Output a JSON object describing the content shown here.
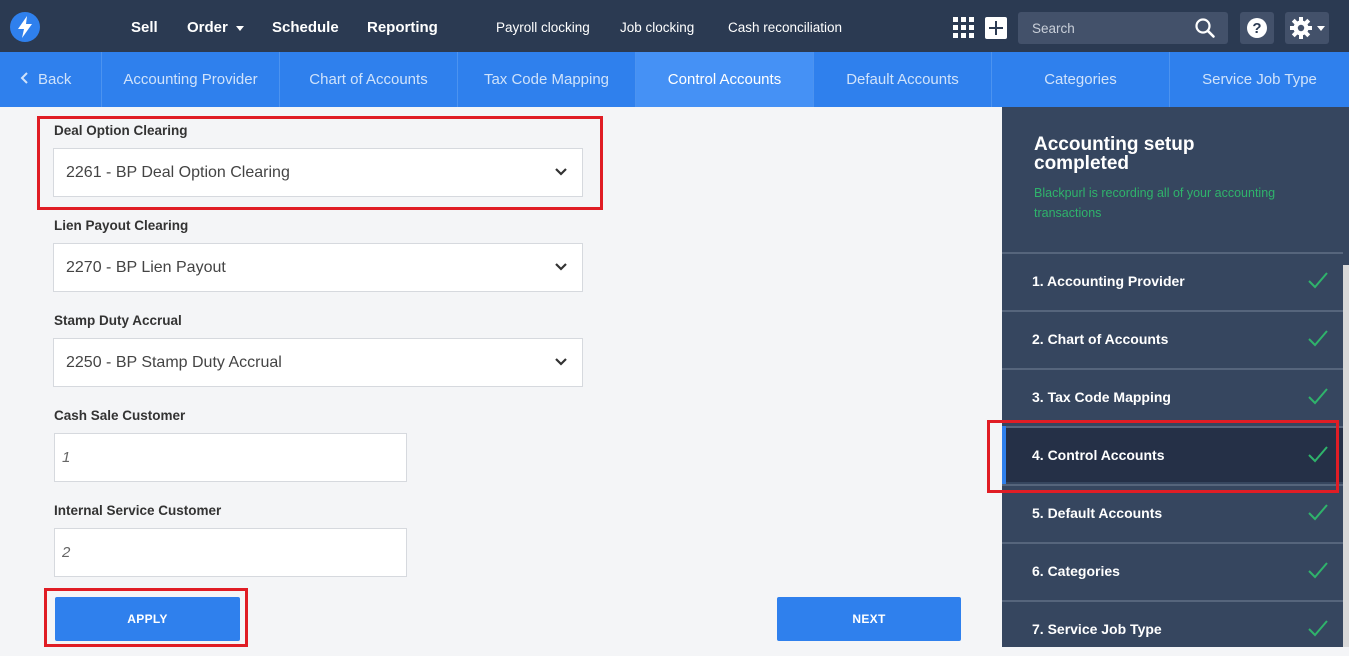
{
  "topnav": {
    "logo_icon": "lightning-bolt-icon",
    "main_items": [
      "Sell",
      "Order",
      "Schedule",
      "Reporting"
    ],
    "sub_items": [
      "Payroll clocking",
      "Job clocking",
      "Cash reconciliation"
    ],
    "search_placeholder": "Search",
    "help_label": "?"
  },
  "tabs": {
    "back": "Back",
    "items": [
      "Accounting Provider",
      "Chart of Accounts",
      "Tax Code Mapping",
      "Control Accounts",
      "Default Accounts",
      "Categories",
      "Service Job Type"
    ],
    "active": "Control Accounts"
  },
  "form": {
    "deal_option_clearing": {
      "label": "Deal Option Clearing",
      "value": "2261 - BP Deal Option Clearing"
    },
    "lien_payout_clearing": {
      "label": "Lien Payout Clearing",
      "value": "2270 - BP Lien Payout"
    },
    "stamp_duty_accrual": {
      "label": "Stamp Duty Accrual",
      "value": "2250 - BP Stamp Duty Accrual"
    },
    "cash_sale_customer": {
      "label": "Cash Sale Customer",
      "value": "1"
    },
    "internal_service_customer": {
      "label": "Internal Service Customer",
      "value": "2"
    },
    "apply_label": "APPLY",
    "next_label": "NEXT"
  },
  "panel": {
    "title": "Accounting setup completed",
    "subtitle": "Blackpurl is recording all of your accounting transactions",
    "steps": [
      {
        "label": "1. Accounting Provider",
        "done": true
      },
      {
        "label": "2. Chart of Accounts",
        "done": true
      },
      {
        "label": "3. Tax Code Mapping",
        "done": true
      },
      {
        "label": "4. Control Accounts",
        "done": true
      },
      {
        "label": "5. Default Accounts",
        "done": true
      },
      {
        "label": "6. Categories",
        "done": true
      },
      {
        "label": "7. Service Job Type",
        "done": true
      }
    ],
    "active_step": "4. Control Accounts"
  },
  "colors": {
    "nav_bg": "#2b3a52",
    "tab_bg": "#2f80ed",
    "panel_bg": "#36465f",
    "success": "#2fb36b",
    "highlight": "#e01d25"
  }
}
